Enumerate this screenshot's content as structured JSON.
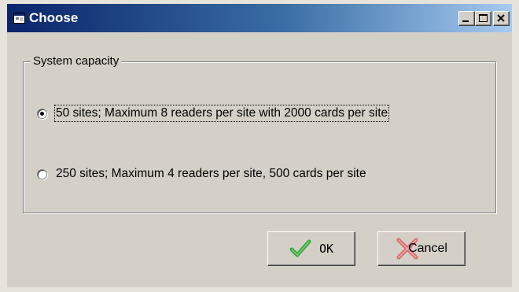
{
  "window": {
    "title": "Choose"
  },
  "title_buttons": {
    "minimize": "_",
    "maximize": "□",
    "close": "×"
  },
  "group": {
    "legend": "System capacity",
    "options": [
      {
        "label": "50 sites; Maximum 8 readers per site with 2000 cards per site",
        "selected": true
      },
      {
        "label": "250 sites; Maximum 4 readers per site, 500 cards per site",
        "selected": false
      }
    ]
  },
  "buttons": {
    "ok_label": "OK",
    "cancel_label": "Cancel"
  },
  "colors": {
    "title_gradient_start": "#0a246a",
    "title_gradient_end": "#a6caf0",
    "dialog_face": "#d4d0c8",
    "ok_check": "#3aa63a",
    "cancel_x": "#d86a6a"
  },
  "icons": {
    "app": "window-app-icon",
    "ok": "check-icon",
    "cancel": "x-mark-icon"
  }
}
